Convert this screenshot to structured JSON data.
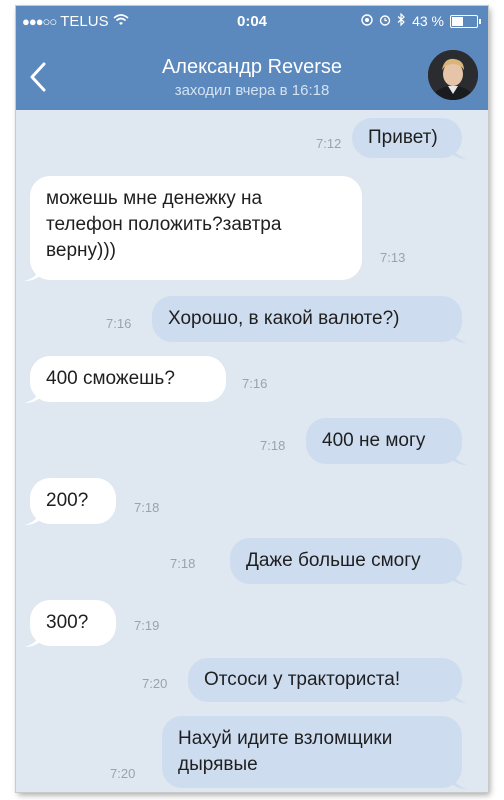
{
  "status_bar": {
    "carrier": "TELUS",
    "time": "0:04",
    "battery": "43 %",
    "battery_level": 0.43
  },
  "header": {
    "name": "Александр Reverse",
    "last_seen": "заходил вчера в 16:18"
  },
  "messages": [
    {
      "dir": "out",
      "text": "Привет)",
      "time": "7:12"
    },
    {
      "dir": "in",
      "text": "можешь мне денежку на телефон положить?завтра верну)))",
      "time": "7:13"
    },
    {
      "dir": "out",
      "text": "Хорошо, в какой валюте?)",
      "time": "7:16"
    },
    {
      "dir": "in",
      "text": "400 сможешь?",
      "time": "7:16"
    },
    {
      "dir": "out",
      "text": "400 не могу",
      "time": "7:18"
    },
    {
      "dir": "in",
      "text": "200?",
      "time": "7:18"
    },
    {
      "dir": "out",
      "text": "Даже больше смогу",
      "time": "7:18"
    },
    {
      "dir": "in",
      "text": "300?",
      "time": "7:19"
    },
    {
      "dir": "out",
      "text": "Отсоси у тракториста!",
      "time": "7:20"
    },
    {
      "dir": "out",
      "text": "Нахуй идите взломщики дырявые",
      "time": "7:20"
    }
  ]
}
